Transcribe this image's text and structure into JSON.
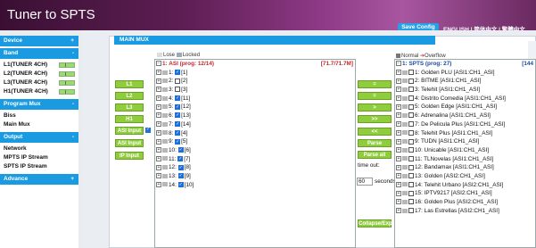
{
  "header": {
    "title": "Tuner to SPTS",
    "save_label": "Save Config",
    "languages": "ENGLISH | 简体中文 | 繁體中文"
  },
  "sidebar": {
    "device": {
      "label": "Device",
      "toggle": "+"
    },
    "band": {
      "label": "Band",
      "toggle": "-",
      "items": [
        {
          "label": "L1(TUNER 4CH)"
        },
        {
          "label": "L2(TUNER 4CH)"
        },
        {
          "label": "L3(TUNER 4CH)"
        },
        {
          "label": "H1(TUNER 4CH)"
        }
      ]
    },
    "program_mux": {
      "label": "Program Mux",
      "toggle": "-",
      "items": [
        {
          "label": "Biss"
        },
        {
          "label": "Main Mux"
        }
      ]
    },
    "output": {
      "label": "Output",
      "toggle": "-",
      "items": [
        {
          "label": "Network"
        },
        {
          "label": "MPTS IP Stream"
        },
        {
          "label": "SPTS IP Stream"
        }
      ]
    },
    "advance": {
      "label": "Advance",
      "toggle": "+"
    }
  },
  "main": {
    "section_title": "MAIN MUX",
    "input_buttons": [
      "L1",
      "L2",
      "L3",
      "H1",
      "ASI Input 1",
      "ASI Input 2",
      "IP Input"
    ],
    "left_legend": {
      "lose": "Lose",
      "locked": "Locked"
    },
    "left_tree": {
      "title": "1: ASI (prog: 12/14)",
      "bitrate": "[71.7/71.7M]",
      "items": [
        {
          "label": "1:",
          "value": "[1]",
          "checked": true
        },
        {
          "label": "2:",
          "value": "[2]",
          "checked": false
        },
        {
          "label": "3:",
          "value": "[3]",
          "checked": false
        },
        {
          "label": "4:",
          "value": "[11]",
          "checked": true
        },
        {
          "label": "5:",
          "value": "[12]",
          "checked": true
        },
        {
          "label": "6:",
          "value": "[13]",
          "checked": true
        },
        {
          "label": "7:",
          "value": "[14]",
          "checked": true
        },
        {
          "label": "8:",
          "value": "[4]",
          "checked": true
        },
        {
          "label": "9:",
          "value": "[5]",
          "checked": true
        },
        {
          "label": "10:",
          "value": "[6]",
          "checked": true
        },
        {
          "label": "11:",
          "value": "[7]",
          "checked": true
        },
        {
          "label": "12:",
          "value": "[8]",
          "checked": true
        },
        {
          "label": "13:",
          "value": "[9]",
          "checked": true
        },
        {
          "label": "14:",
          "value": "[10]",
          "checked": true
        }
      ]
    },
    "ops": [
      "=",
      "=",
      ">",
      ">>",
      "<<",
      "Parse program",
      "Parse all"
    ],
    "timeout_label": "time out:",
    "timeout_value": "60",
    "timeout_unit": "seconds",
    "collapse_label": "Collapse/Exp",
    "right_legend": {
      "normal": "Normal",
      "overflow": "Overflow"
    },
    "right_tree": {
      "title": "1: SPTS (prog: 27)",
      "bitrate": "[144",
      "items": [
        "1: Golden PLU [ASI1:CH1_ASI]",
        "2: BITME [ASI1:CH1_ASI]",
        "3: Telehit [ASI1:CH1_ASI]",
        "4: Distrito Comedia [ASI1:CH1_ASI]",
        "5: Golden Edge [ASI1:CH1_ASI]",
        "6: Adrenalina [ASI1:CH1_ASI]",
        "7: De Pelicula Plus [ASI1:CH1_ASI]",
        "8: Telehit Plus [ASI1:CH1_ASI]",
        "9: TUDN [ASI1:CH1_ASI]",
        "10: Unicable [ASI1:CH1_ASI]",
        "11: TLNovelas [ASI1:CH1_ASI]",
        "12: Bandamax [ASI1:CH1_ASI]",
        "13: Golden [ASI2:CH1_ASI]",
        "14: Telehit Urbano [ASI2:CH1_ASI]",
        "15: IPTV9217 [ASI2:CH1_ASI]",
        "16: Golden Plus [ASI2:CH1_ASI]",
        "17: Las Estrellas [ASI2:CH1_ASI]"
      ]
    }
  }
}
